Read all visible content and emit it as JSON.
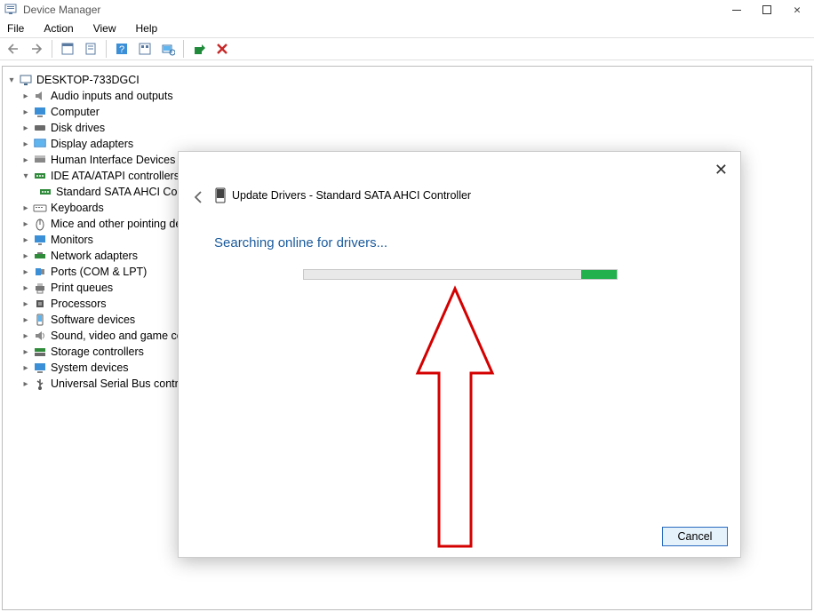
{
  "window": {
    "title": "Device Manager"
  },
  "menu": {
    "file": "File",
    "action": "Action",
    "view": "View",
    "help": "Help"
  },
  "tree": {
    "root": "DESKTOP-733DGCI",
    "items": [
      "Audio inputs and outputs",
      "Computer",
      "Disk drives",
      "Display adapters",
      "Human Interface Devices",
      "IDE ATA/ATAPI controllers",
      "Keyboards",
      "Mice and other pointing de",
      "Monitors",
      "Network adapters",
      "Ports (COM & LPT)",
      "Print queues",
      "Processors",
      "Software devices",
      "Sound, video and game co",
      "Storage controllers",
      "System devices",
      "Universal Serial Bus contro"
    ],
    "subitem": "Standard SATA AHCI Co"
  },
  "dialog": {
    "title": "Update Drivers - Standard SATA AHCI Controller",
    "message": "Searching online for drivers...",
    "cancel": "Cancel"
  }
}
